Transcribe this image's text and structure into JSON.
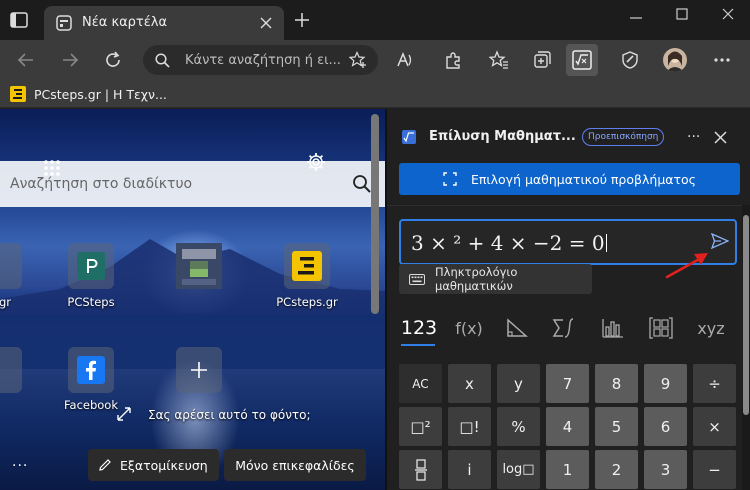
{
  "browser": {
    "tab_title": "Νέα καρτέλα",
    "address_placeholder": "Κάντε αναζήτηση ή ει...",
    "favorite_label": "PCsteps.gr | Η Τεχν..."
  },
  "new_tab_page": {
    "search_placeholder": "Αναζήτηση στο διαδίκτυο",
    "tiles": [
      {
        "label": "gr"
      },
      {
        "label": "PCSteps"
      },
      {
        "label": ""
      },
      {
        "label": "PCsteps.gr"
      },
      {
        "label": "Facebook"
      }
    ],
    "bg_question": "Σας αρέσει αυτό το φόντο;",
    "more_dots": "···",
    "customize_label": "Εξατομίκευση",
    "headlines_label": "Μόνο επικεφαλίδες"
  },
  "math_solver": {
    "title": "Επίλυση Μαθηματ...",
    "preview_badge": "Προεπισκόπηση",
    "more_label": "···",
    "select_problem_label": "Επιλογή μαθηματικού προβλήματος",
    "expression": "3 × ² + 4 × −2 = 0",
    "keyboard_toggle_label": "Πληκτρολόγιο μαθηματικών",
    "keyboard_tabs": [
      "123",
      "f(x)",
      "triangle-icon",
      "sum-integral-icon",
      "bar-chart-icon",
      "matrix-icon",
      "xyz"
    ],
    "keys": [
      [
        "AC",
        "x",
        "y",
        "7",
        "8",
        "9",
        "÷"
      ],
      [
        "□²",
        "□!",
        "%",
        "4",
        "5",
        "6",
        "×"
      ],
      [
        "fraction",
        "i",
        "log□",
        "1",
        "2",
        "3",
        "−"
      ]
    ]
  },
  "colors": {
    "accent": "#2f7fe6",
    "select_button": "#0c64cc",
    "annotation_arrow": "#e0211f"
  }
}
